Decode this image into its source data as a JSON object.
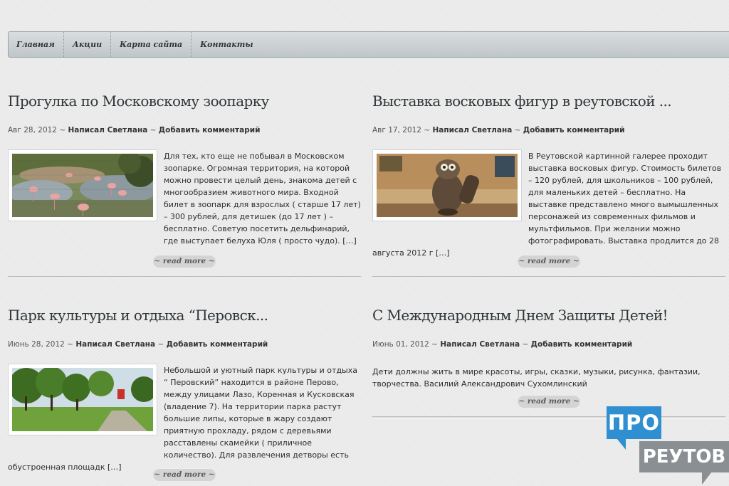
{
  "nav": {
    "items": [
      "Главная",
      "Акции",
      "Карта сайта",
      "Контакты"
    ]
  },
  "posts": [
    {
      "title": "Прогулка по Московскому зоопарку",
      "date": "Авг 28, 2012",
      "sep1": " ~ ",
      "author": "Написал Светлана",
      "sep2": " ~ ",
      "comments": "Добавить комментарий",
      "excerpt": "Для тех, кто еще не побывал в Московском зоопарке. Огромная территория, на которой можно провести целый день, знакома детей с многообразием животного мира. Входной билет в зоопарк для взрослых ( старше 17 лет) – 300 рублей, для детишек (до 17 лет ) – бесплатно. Советую посетить дельфинарий, где выступает белуха Юля ( просто чудо). […]",
      "read_more": "~ read more ~"
    },
    {
      "title": "Выставка восковых фигур в реутовской ...",
      "date": "Авг 17, 2012",
      "sep1": " ~ ",
      "author": "Написал Светлана",
      "sep2": " ~ ",
      "comments": "Добавить комментарий",
      "excerpt": "В Реутовской картинной галерее проходит выставка восковых фигур. Стоимость билетов – 120 рублей, для школьников – 100 рублей, для маленьких детей – бесплатно. На выставке представлено много вымышленных персонажей из современных фильмов и мультфильмов. При желании можно фотографировать. Выставка продлится до 28 августа 2012 г […]",
      "read_more": "~ read more ~"
    },
    {
      "title": "Парк культуры и отдыха “Перовск...",
      "date": "Июнь 28, 2012",
      "sep1": " ~ ",
      "author": "Написал Светлана",
      "sep2": " ~ ",
      "comments": "Добавить комментарий",
      "excerpt": "Небольшой и уютный парк культуры и отдыха “ Перовский” находится в районе Перово, между улицами Лазо, Коренная и Кусковская (владение 7). На территории парка растут большие липы, которые в жару создают приятную прохладу, рядом с деревьями расставлены скамейки ( приличное количество). Для развлечения детворы есть обустроенная площадк […]",
      "read_more": "~ read more ~"
    },
    {
      "title": "С Международным Днем Защиты Детей!",
      "date": "Июнь 01, 2012",
      "sep1": " ~ ",
      "author": "Написал Светлана",
      "sep2": " ~ ",
      "comments": "Добавить комментарий",
      "excerpt": "Дети должны жить в мире красоты, игры, сказки, музыки, рисунка, фантазии, творчества. Василий Александрович Сухомлинский",
      "read_more": "~ read more ~"
    }
  ],
  "logo": {
    "top": "ПРО",
    "bottom": "РЕУТОВ"
  },
  "colors": {
    "logo_blue": "#2f8fd1",
    "logo_gray": "#8a8f93",
    "nav_bg": "#c8cfd2"
  }
}
